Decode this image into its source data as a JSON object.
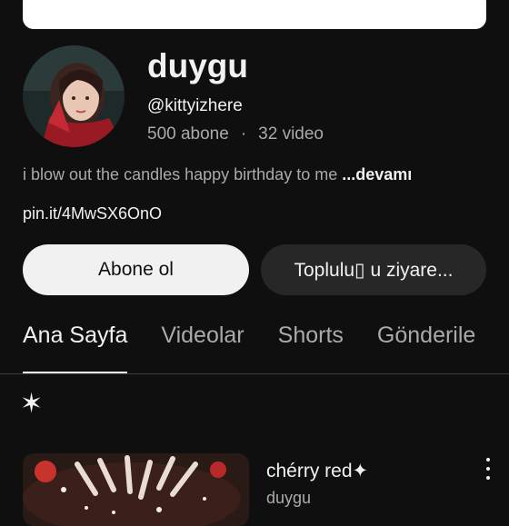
{
  "channel": {
    "name": "duygu",
    "handle": "@kittyizhere",
    "subscribers": "500 abone",
    "separator": "·",
    "videos": "32 video",
    "description": "i blow out the candles happy birthday to me",
    "more_label": "...devamı",
    "link": "pin.it/4MwSX6OnO"
  },
  "buttons": {
    "subscribe": "Abone ol",
    "community": "Toplulu▯ u ziyare..."
  },
  "tabs": [
    {
      "label": "Ana Sayfa",
      "active": true
    },
    {
      "label": "Videolar",
      "active": false
    },
    {
      "label": "Shorts",
      "active": false
    },
    {
      "label": "Gönderile",
      "active": false
    }
  ],
  "section": {
    "star_glyph": "✶"
  },
  "video": {
    "title": "chérry red✦",
    "channel": "duygu"
  },
  "colors": {
    "background": "#0f0f0f",
    "subscribe_bg": "#f1f1f1",
    "secondary_button_bg": "#272727",
    "muted_text": "#aaaaaa"
  }
}
